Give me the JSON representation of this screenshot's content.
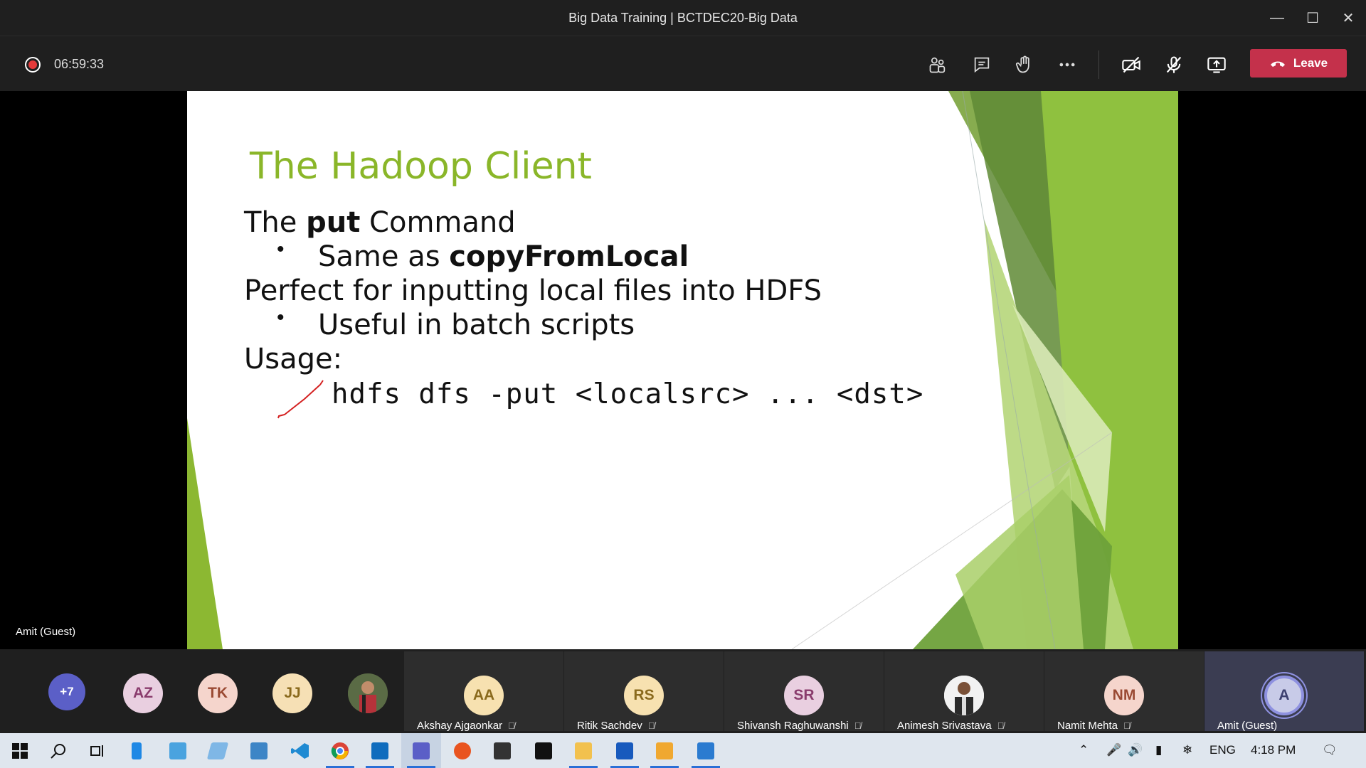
{
  "window": {
    "title": "Big Data Training | BCTDEC20-Big Data"
  },
  "meeting": {
    "recording_timer": "06:59:33",
    "leave_label": "Leave",
    "presenter_label": "Amit (Guest)"
  },
  "slide": {
    "title": "The Hadoop Client",
    "line1_pre": "The ",
    "line1_bold": "put",
    "line1_post": " Command",
    "bullet1_pre": "Same as ",
    "bullet1_bold": "copyFromLocal",
    "line2": "Perfect for inputting local files into HDFS",
    "bullet2": "Useful in batch scripts",
    "line3": "Usage:",
    "command": "hdfs dfs -put <localsrc> ... <dst>"
  },
  "participants": {
    "overflow_count": "+7",
    "avatars": [
      {
        "initials": "AZ"
      },
      {
        "initials": "TK"
      },
      {
        "initials": "JJ"
      }
    ],
    "tiles": [
      {
        "initials": "AA",
        "name": "Akshay Ajgaonkar"
      },
      {
        "initials": "RS",
        "name": "Ritik Sachdev"
      },
      {
        "initials": "SR",
        "name": "Shivansh Raghuwanshi"
      },
      {
        "initials": "",
        "name": "Animesh Srivastava"
      },
      {
        "initials": "NM",
        "name": "Namit Mehta"
      },
      {
        "initials": "A",
        "name": "Amit (Guest)"
      }
    ]
  },
  "taskbar": {
    "language": "ENG",
    "clock": "4:18 PM"
  },
  "colors": {
    "leave": "#c4314b",
    "slide_accent": "#8ab629",
    "recording": "#e33a3a"
  }
}
